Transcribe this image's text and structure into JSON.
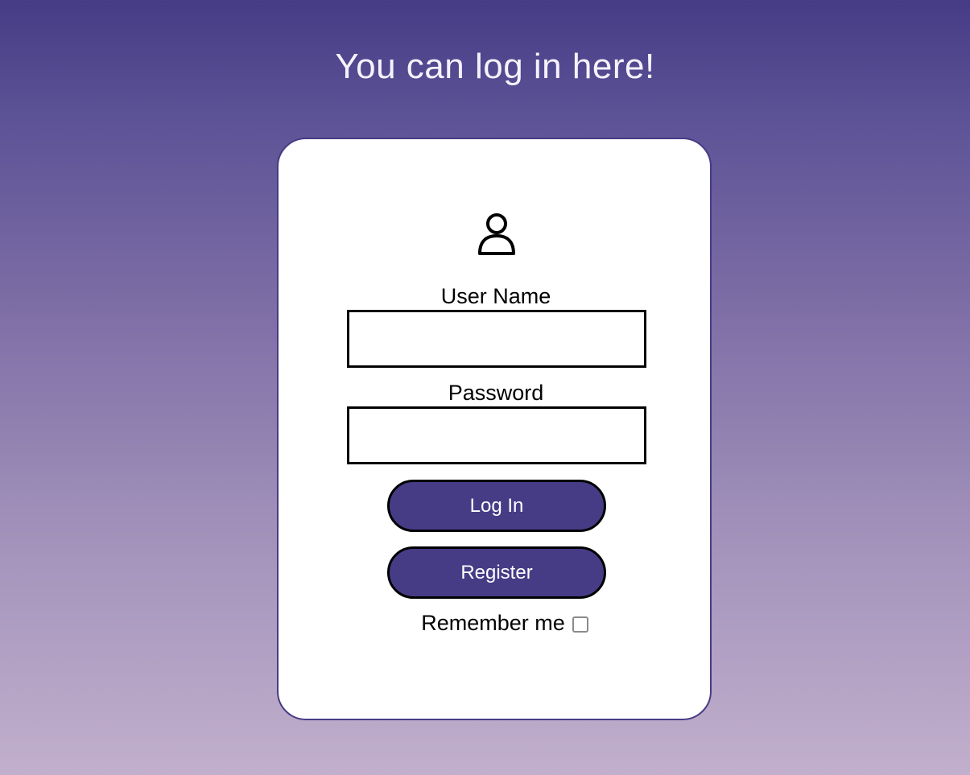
{
  "page": {
    "heading": "You can log in here!"
  },
  "login_card": {
    "icon": "user-icon",
    "username_label": "User Name",
    "username_value": "",
    "password_label": "Password",
    "password_value": "",
    "login_button": "Log In",
    "register_button": "Register",
    "remember_label": "Remember me",
    "remember_checked": false
  },
  "colors": {
    "accent": "#463c86",
    "gradient_top": "#463c86",
    "gradient_bottom": "#c2afcd",
    "card_background": "#ffffff"
  }
}
